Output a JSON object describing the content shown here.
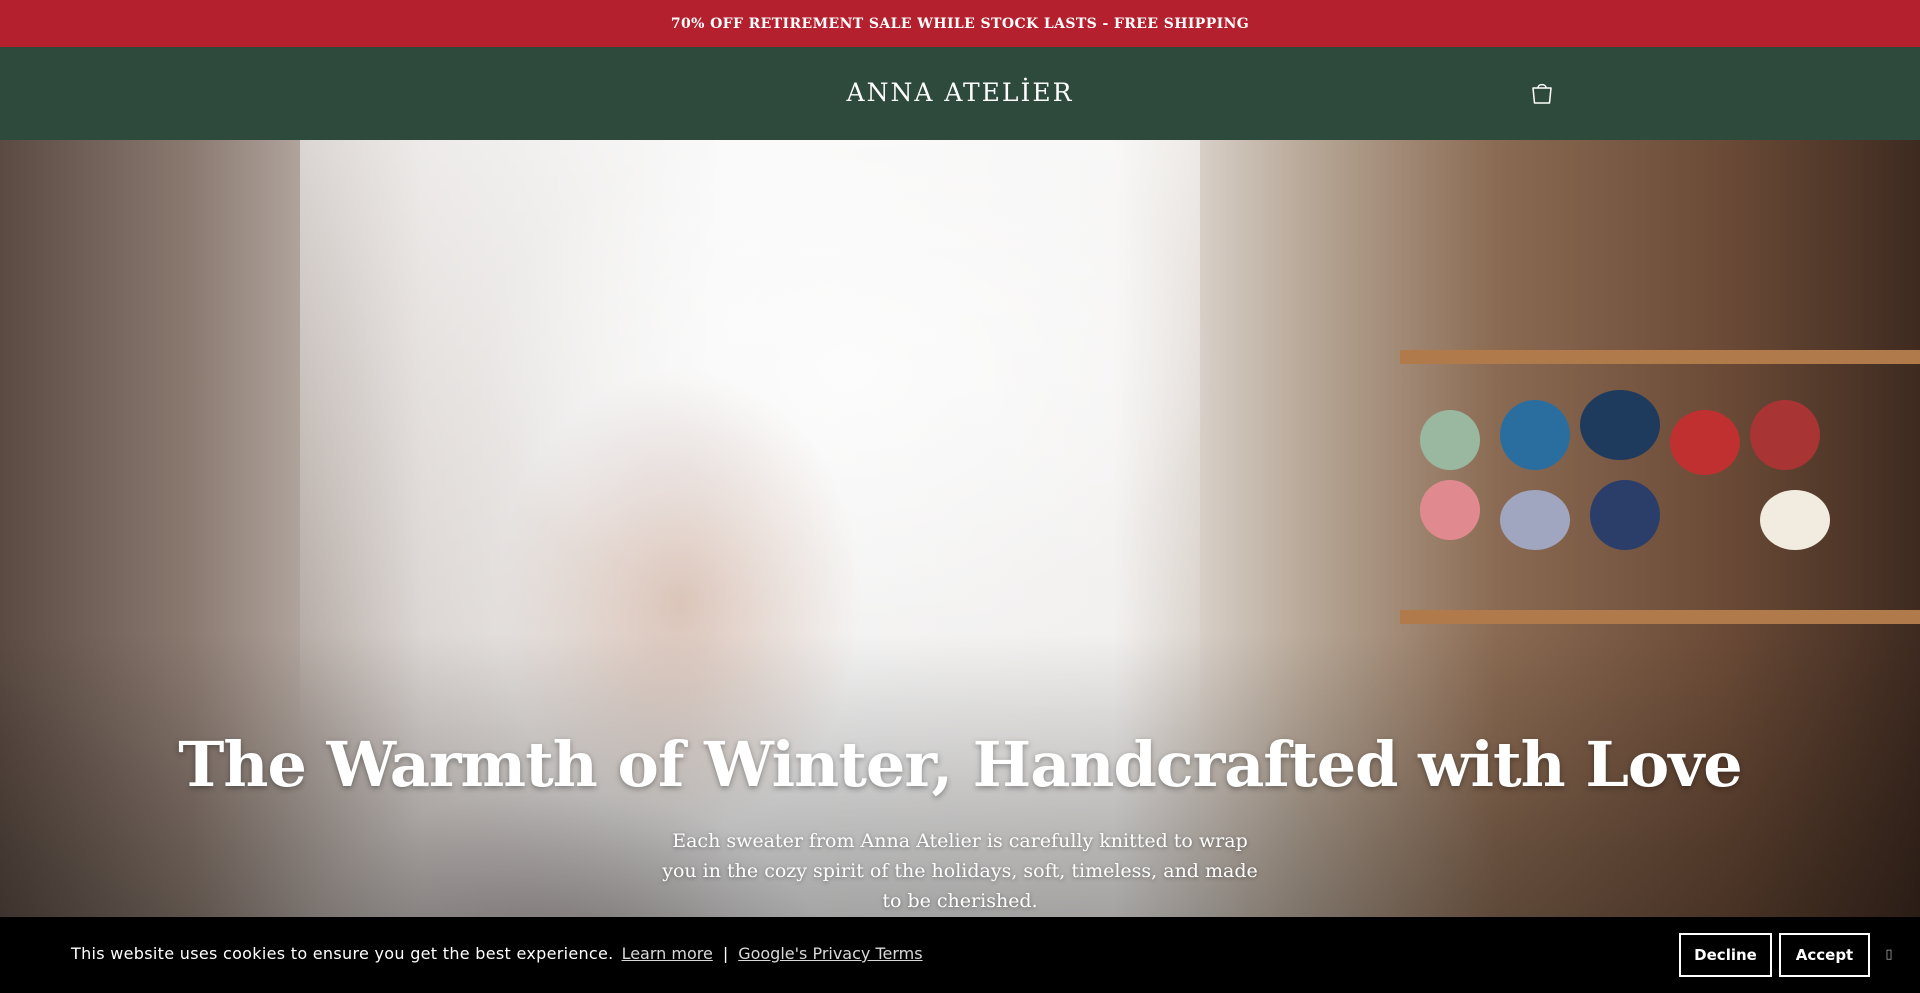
{
  "announcement": {
    "text": "70% OFF RETIREMENT SALE WHILE STOCK LASTS - FREE SHIPPING"
  },
  "header": {
    "logo": "ANNA ATELİER",
    "cart_icon": "cart-icon"
  },
  "hero": {
    "title": "The Warmth of Winter, Handcrafted with Love",
    "subtitle": "Each sweater from Anna Atelier is carefully knitted to wrap you in the cozy spirit of the holidays, soft, timeless, and made to be cherished."
  },
  "cookie_banner": {
    "message": "This website uses cookies to ensure you get the best experience.",
    "learn_more": "Learn more",
    "separator": "|",
    "privacy_link": "Google's Privacy Terms",
    "decline": "Decline",
    "accept": "Accept"
  },
  "colors": {
    "announcement_bg": "#b5202e",
    "header_bg": "#2d4a3d",
    "cookie_bg": "#000000"
  }
}
